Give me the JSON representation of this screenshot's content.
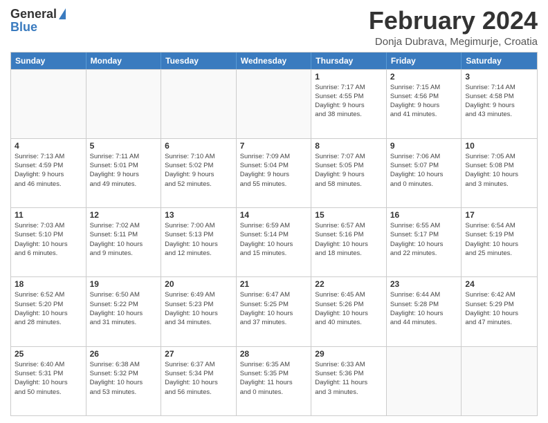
{
  "header": {
    "logo_general": "General",
    "logo_blue": "Blue",
    "month_year": "February 2024",
    "location": "Donja Dubrava, Megimurje, Croatia"
  },
  "calendar": {
    "days_of_week": [
      "Sunday",
      "Monday",
      "Tuesday",
      "Wednesday",
      "Thursday",
      "Friday",
      "Saturday"
    ],
    "weeks": [
      [
        {
          "day": "",
          "info": ""
        },
        {
          "day": "",
          "info": ""
        },
        {
          "day": "",
          "info": ""
        },
        {
          "day": "",
          "info": ""
        },
        {
          "day": "1",
          "info": "Sunrise: 7:17 AM\nSunset: 4:55 PM\nDaylight: 9 hours\nand 38 minutes."
        },
        {
          "day": "2",
          "info": "Sunrise: 7:15 AM\nSunset: 4:56 PM\nDaylight: 9 hours\nand 41 minutes."
        },
        {
          "day": "3",
          "info": "Sunrise: 7:14 AM\nSunset: 4:58 PM\nDaylight: 9 hours\nand 43 minutes."
        }
      ],
      [
        {
          "day": "4",
          "info": "Sunrise: 7:13 AM\nSunset: 4:59 PM\nDaylight: 9 hours\nand 46 minutes."
        },
        {
          "day": "5",
          "info": "Sunrise: 7:11 AM\nSunset: 5:01 PM\nDaylight: 9 hours\nand 49 minutes."
        },
        {
          "day": "6",
          "info": "Sunrise: 7:10 AM\nSunset: 5:02 PM\nDaylight: 9 hours\nand 52 minutes."
        },
        {
          "day": "7",
          "info": "Sunrise: 7:09 AM\nSunset: 5:04 PM\nDaylight: 9 hours\nand 55 minutes."
        },
        {
          "day": "8",
          "info": "Sunrise: 7:07 AM\nSunset: 5:05 PM\nDaylight: 9 hours\nand 58 minutes."
        },
        {
          "day": "9",
          "info": "Sunrise: 7:06 AM\nSunset: 5:07 PM\nDaylight: 10 hours\nand 0 minutes."
        },
        {
          "day": "10",
          "info": "Sunrise: 7:05 AM\nSunset: 5:08 PM\nDaylight: 10 hours\nand 3 minutes."
        }
      ],
      [
        {
          "day": "11",
          "info": "Sunrise: 7:03 AM\nSunset: 5:10 PM\nDaylight: 10 hours\nand 6 minutes."
        },
        {
          "day": "12",
          "info": "Sunrise: 7:02 AM\nSunset: 5:11 PM\nDaylight: 10 hours\nand 9 minutes."
        },
        {
          "day": "13",
          "info": "Sunrise: 7:00 AM\nSunset: 5:13 PM\nDaylight: 10 hours\nand 12 minutes."
        },
        {
          "day": "14",
          "info": "Sunrise: 6:59 AM\nSunset: 5:14 PM\nDaylight: 10 hours\nand 15 minutes."
        },
        {
          "day": "15",
          "info": "Sunrise: 6:57 AM\nSunset: 5:16 PM\nDaylight: 10 hours\nand 18 minutes."
        },
        {
          "day": "16",
          "info": "Sunrise: 6:55 AM\nSunset: 5:17 PM\nDaylight: 10 hours\nand 22 minutes."
        },
        {
          "day": "17",
          "info": "Sunrise: 6:54 AM\nSunset: 5:19 PM\nDaylight: 10 hours\nand 25 minutes."
        }
      ],
      [
        {
          "day": "18",
          "info": "Sunrise: 6:52 AM\nSunset: 5:20 PM\nDaylight: 10 hours\nand 28 minutes."
        },
        {
          "day": "19",
          "info": "Sunrise: 6:50 AM\nSunset: 5:22 PM\nDaylight: 10 hours\nand 31 minutes."
        },
        {
          "day": "20",
          "info": "Sunrise: 6:49 AM\nSunset: 5:23 PM\nDaylight: 10 hours\nand 34 minutes."
        },
        {
          "day": "21",
          "info": "Sunrise: 6:47 AM\nSunset: 5:25 PM\nDaylight: 10 hours\nand 37 minutes."
        },
        {
          "day": "22",
          "info": "Sunrise: 6:45 AM\nSunset: 5:26 PM\nDaylight: 10 hours\nand 40 minutes."
        },
        {
          "day": "23",
          "info": "Sunrise: 6:44 AM\nSunset: 5:28 PM\nDaylight: 10 hours\nand 44 minutes."
        },
        {
          "day": "24",
          "info": "Sunrise: 6:42 AM\nSunset: 5:29 PM\nDaylight: 10 hours\nand 47 minutes."
        }
      ],
      [
        {
          "day": "25",
          "info": "Sunrise: 6:40 AM\nSunset: 5:31 PM\nDaylight: 10 hours\nand 50 minutes."
        },
        {
          "day": "26",
          "info": "Sunrise: 6:38 AM\nSunset: 5:32 PM\nDaylight: 10 hours\nand 53 minutes."
        },
        {
          "day": "27",
          "info": "Sunrise: 6:37 AM\nSunset: 5:34 PM\nDaylight: 10 hours\nand 56 minutes."
        },
        {
          "day": "28",
          "info": "Sunrise: 6:35 AM\nSunset: 5:35 PM\nDaylight: 11 hours\nand 0 minutes."
        },
        {
          "day": "29",
          "info": "Sunrise: 6:33 AM\nSunset: 5:36 PM\nDaylight: 11 hours\nand 3 minutes."
        },
        {
          "day": "",
          "info": ""
        },
        {
          "day": "",
          "info": ""
        }
      ]
    ]
  }
}
